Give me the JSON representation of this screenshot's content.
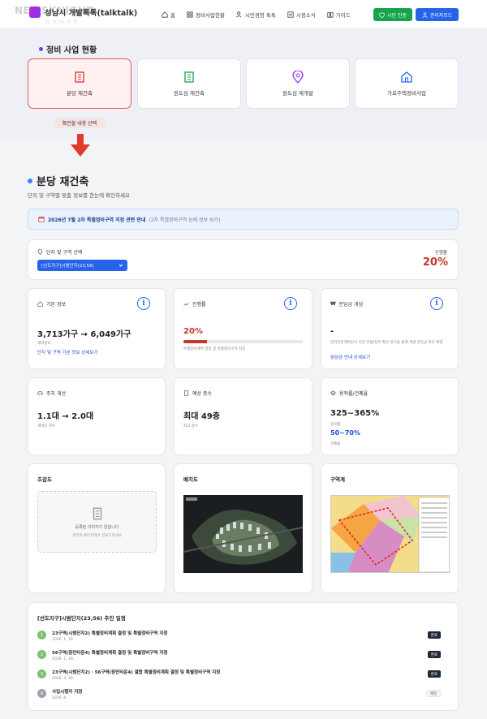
{
  "header": {
    "logo_text": "성남시 개발톡톡(talktalk)",
    "watermark": "NEWSKNIGHT",
    "watermark_sub": "뉴스나이트",
    "nav": [
      {
        "label": "홈",
        "icon": "home-icon"
      },
      {
        "label": "정비사업현황",
        "icon": "grid-icon"
      },
      {
        "label": "시민경청 톡톡",
        "icon": "users-icon"
      },
      {
        "label": "시정소식",
        "icon": "news-icon"
      },
      {
        "label": "가이드",
        "icon": "book-icon"
      }
    ],
    "citizen_auth": "시민 인증",
    "admin_mode": "관리자모드"
  },
  "status": {
    "section_title": "정비 사업 현황",
    "tabs": [
      {
        "label": "분당 재건축"
      },
      {
        "label": "원도심 재건축"
      },
      {
        "label": "원도심 재개발"
      },
      {
        "label": "가로주택정비사업"
      }
    ],
    "tooltip": "확인할 내용 선택"
  },
  "main": {
    "title": "분당 재건축",
    "subtitle": "단지 및 구역별 맞춤 정보를 한눈에 확인하세요",
    "notice_title": "2026년 7월 2차 특별정비구역 지정 관련 안내",
    "notice_sub": "(2차 특별정비구역 상세 정보 보기)"
  },
  "selector": {
    "label": "단지 및 구역 선택",
    "value": "[선도지구]시범단지(23,56)",
    "progress_label": "진행률",
    "progress_value": "20%"
  },
  "cards": {
    "basic": {
      "label": "기본 정보",
      "value": "3,713가구 → 6,049가구",
      "sub": "세대정보",
      "link": "단지 및 구역 기본 정보 상세보기"
    },
    "progress": {
      "label": "진행률",
      "value": "20%",
      "fraction": 0.2,
      "sub": "특별정비계획 결정 및 특별정비구역 지정"
    },
    "contribution": {
      "label": "분담금 개념",
      "value": "-",
      "sub": "관리처분계획인가 이전 조합/정부 확산 탄기술 통해 개별 분담금 파초 확정",
      "link": "분담금 안내 상세보기"
    },
    "parking": {
      "label": "주차 개선",
      "value": "1.1대 → 2.0대",
      "sub": "세대당 대수"
    },
    "floors": {
      "label": "예상 층수",
      "value": "최대 49층",
      "sub": "최고 층수"
    },
    "ratio": {
      "label": "용적률/건폐율",
      "value": "325~365%",
      "sub": "용적률",
      "value2": "50~70%",
      "sub2": "건폐율"
    }
  },
  "images": {
    "bird_title": "조감도",
    "bird_empty1": "등록된 이미지가 없습니다",
    "bird_empty2": "관리자 페이지에서 업로드하세요",
    "layout_title": "배치도",
    "zone_title": "구역계"
  },
  "timeline": {
    "title": "[선도지구]시범단지(23,56) 추진 일정",
    "items": [
      {
        "num": "1",
        "text": "23구역(시범단지2) 특별정비계획 결정 및 특별정비구역 지정",
        "date": "2026. 1. 19.",
        "badge": "완료"
      },
      {
        "num": "2",
        "text": "56구역(장안타운4) 특별정비계획 결정 및 특별정비구역 지정",
        "date": "2026. 1. 19.",
        "badge": "완료"
      },
      {
        "num": "3",
        "text": "23구역(시범단지2) · 56구역(장안타운4) 결합 특별정비계획 결정 및 특별정비구역 지정",
        "date": "2026. 4. 30.",
        "badge": "완료"
      },
      {
        "num": "4",
        "text": "사업시행자 지정",
        "date": "2026. 6.",
        "badge": "예정"
      }
    ]
  }
}
